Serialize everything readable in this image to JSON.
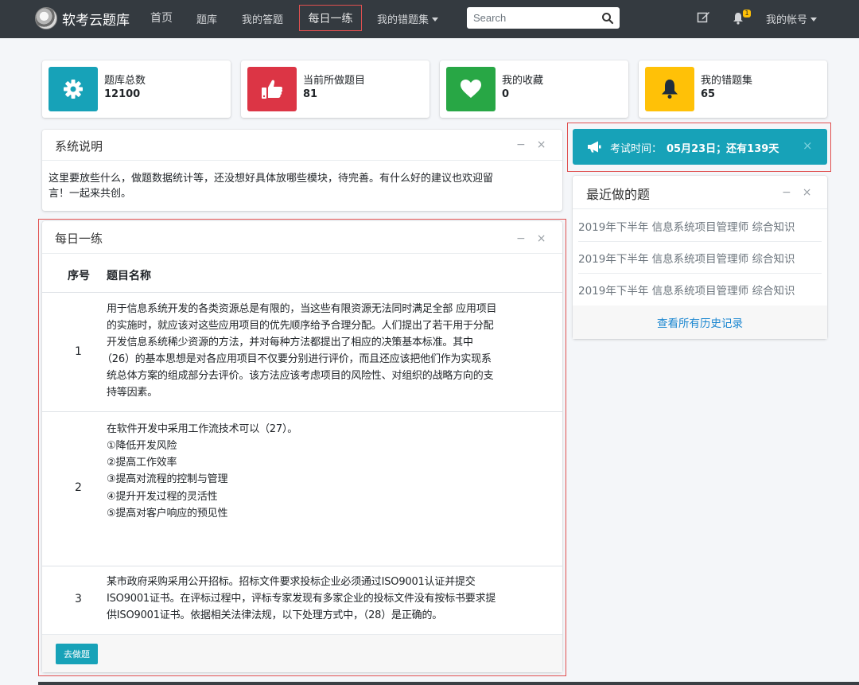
{
  "navbar": {
    "brand": "软考云题库",
    "items": [
      "首页",
      "题库",
      "我的答题"
    ],
    "active": "每日一练",
    "wrong_set": "我的错题集",
    "search_placeholder": "Search",
    "notify_count": "1",
    "account": "我的帐号"
  },
  "stats": [
    {
      "label": "题库总数",
      "value": "12100",
      "color": "#17a2b8",
      "icon": "gear-icon"
    },
    {
      "label": "当前所做题目",
      "value": "81",
      "color": "#dc3545",
      "icon": "thumbs-up-icon"
    },
    {
      "label": "我的收藏",
      "value": "0",
      "color": "#28a745",
      "icon": "heart-icon"
    },
    {
      "label": "我的错题集",
      "value": "65",
      "color": "#ffc107",
      "icon": "bell-icon"
    }
  ],
  "system": {
    "title": "系统说明",
    "lines": [
      "这里要放些什么，做题数据统计等，还没想好具体放哪些模块，待完善。有什么好的建议也欢迎留",
      "言！一起来共创。"
    ]
  },
  "daily": {
    "title": "每日一练",
    "col_no": "序号",
    "col_name": "题目名称",
    "rows": [
      {
        "no": "1",
        "lines": [
          "用于信息系统开发的各类资源总是有限的，当这些有限资源无法同时满足全部 应用项目",
          "的实施时，就应该对这些应用项目的优先顺序给予合理分配。人们提出了若干用于分配",
          "开发信息系统稀少资源的方法，并对每种方法都提出了相应的决策基本标准。其中",
          "（26）的基本思想是对各应用项目不仅要分别进行评价，而且还应该把他们作为实现系",
          "统总体方案的组成部分去评价。该方法应该考虑项目的风险性、对组织的战略方向的支",
          "持等因素。"
        ]
      },
      {
        "no": "2",
        "lines": [
          "在软件开发中采用工作流技术可以（27）。",
          "①降低开发风险",
          "②提高工作效率",
          "③提高对流程的控制与管理",
          "④提升开发过程的灵活性",
          "⑤提高对客户响应的预见性"
        ]
      },
      {
        "no": "3",
        "lines": [
          "某市政府采购采用公开招标。招标文件要求投标企业必须通过ISO9001认证并提交",
          "ISO9001证书。在评标过程中，评标专家发现有多家企业的投标文件没有按标书要求提",
          "供ISO9001证书。依据相关法律法规，以下处理方式中，（28）是正确的。"
        ]
      }
    ],
    "go_button": "去做题"
  },
  "exam_alert": {
    "prefix": "考试时间：",
    "bold": "05月23日；还有139天"
  },
  "recent": {
    "title": "最近做的题",
    "items": [
      "2019年下半年 信息系统项目管理师 综合知识",
      "2019年下半年 信息系统项目管理师 综合知识",
      "2019年下半年 信息系统项目管理师 综合知识"
    ],
    "all_link": "查看所有历史记录"
  },
  "tools": {
    "minimize": "−",
    "close": "×"
  }
}
